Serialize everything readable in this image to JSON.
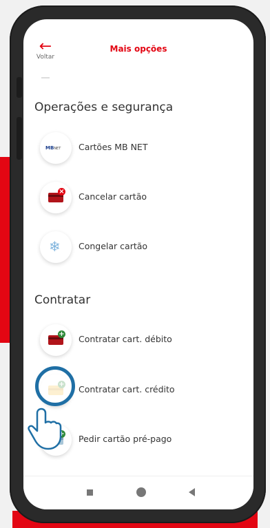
{
  "header": {
    "back_label": "Voltar",
    "title": "Mais opções"
  },
  "sections": [
    {
      "title": "Operações e segurança",
      "items": [
        {
          "label": "Cartões MB NET",
          "icon": "mbnet-icon"
        },
        {
          "label": "Cancelar cartão",
          "icon": "cancel-card-icon"
        },
        {
          "label": "Congelar cartão",
          "icon": "snowflake-icon"
        }
      ]
    },
    {
      "title": "Contratar",
      "items": [
        {
          "label": "Contratar cart. débito",
          "icon": "add-debit-card-icon"
        },
        {
          "label": "Contratar cart. crédito",
          "icon": "add-credit-card-icon"
        },
        {
          "label": "Pedir cartão pré-pago",
          "icon": "add-prepaid-card-icon"
        }
      ]
    }
  ],
  "icons": {
    "mbnet_text": "MB",
    "mbnet_small": "NET"
  },
  "colors": {
    "brand_red": "#e30613",
    "highlight_blue": "#1f6fa5",
    "plus_green": "#2f8a3a"
  }
}
